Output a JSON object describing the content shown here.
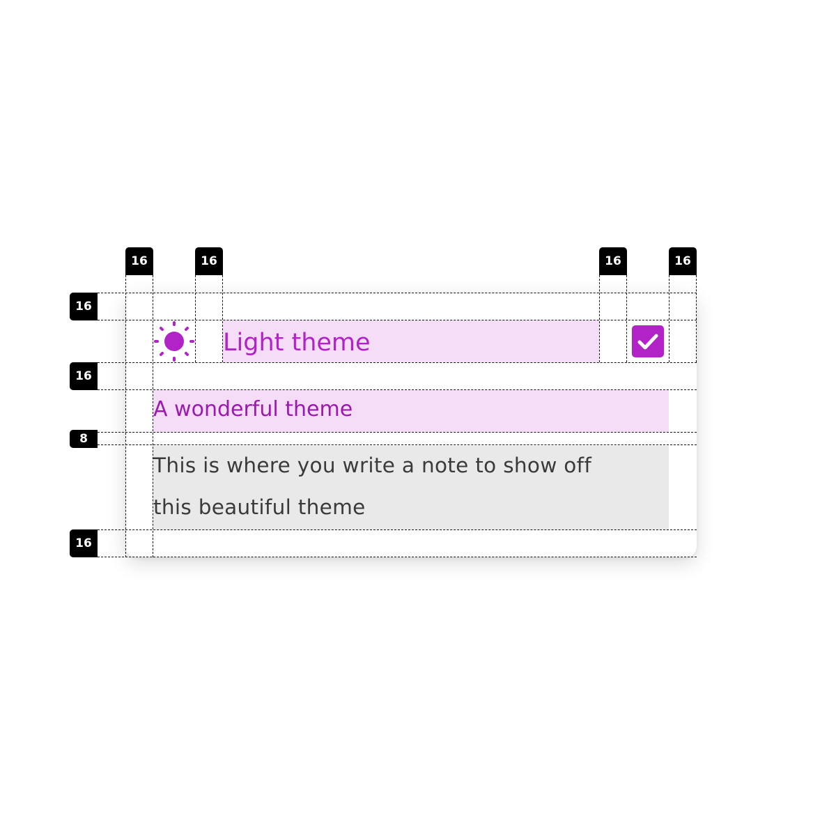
{
  "card": {
    "title": "Light theme",
    "subtitle": "A wonderful theme",
    "description_line1": "This is where you write a note to show off",
    "description_line2": "this beautiful theme",
    "icon": "sun-icon",
    "checkbox_checked": true,
    "checkbox_icon": "check-icon"
  },
  "spacing_badges": {
    "top": [
      "16",
      "16",
      "16",
      "16"
    ],
    "left": [
      "16",
      "16",
      "8",
      "16"
    ]
  },
  "colors": {
    "accent": "#b123c7",
    "accent_dark": "#9b1aae",
    "text_highlight": "#f5dcf7",
    "body_highlight": "#e9e9e9",
    "body_text": "#3a3a3a",
    "badge_bg": "#000000"
  }
}
